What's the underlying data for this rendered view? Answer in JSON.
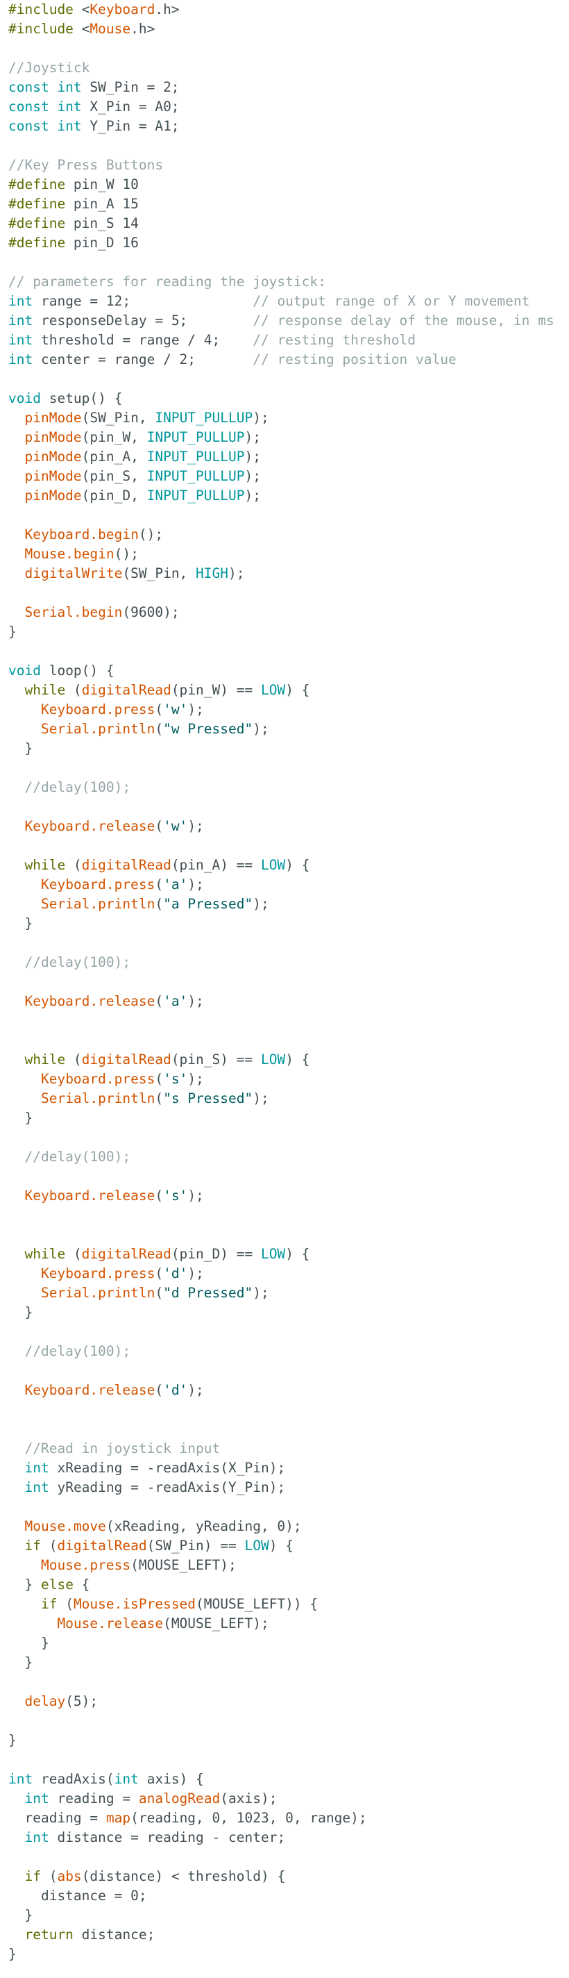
{
  "editor": {
    "language": "Arduino C++",
    "colors": {
      "background": "#ffffff",
      "plain": "#434f54",
      "preprocessor": "#5e6d03",
      "keyword": "#00979c",
      "function": "#d35400",
      "string": "#005c5f",
      "comment": "#95a5a6"
    },
    "lines": [
      [
        [
          "pre",
          "#include"
        ],
        [
          "plain",
          " <"
        ],
        [
          "lib",
          "Keyboard"
        ],
        [
          "plain",
          ".h>"
        ]
      ],
      [
        [
          "pre",
          "#include"
        ],
        [
          "plain",
          " <"
        ],
        [
          "lib",
          "Mouse"
        ],
        [
          "plain",
          ".h>"
        ]
      ],
      [],
      [
        [
          "comment",
          "//Joystick"
        ]
      ],
      [
        [
          "type",
          "const int"
        ],
        [
          "plain",
          " SW_Pin = 2;"
        ]
      ],
      [
        [
          "type",
          "const int"
        ],
        [
          "plain",
          " X_Pin = A0;"
        ]
      ],
      [
        [
          "type",
          "const int"
        ],
        [
          "plain",
          " Y_Pin = A1;"
        ]
      ],
      [],
      [
        [
          "comment",
          "//Key Press Buttons"
        ]
      ],
      [
        [
          "pre",
          "#define"
        ],
        [
          "plain",
          " pin_W 10"
        ]
      ],
      [
        [
          "pre",
          "#define"
        ],
        [
          "plain",
          " pin_A 15"
        ]
      ],
      [
        [
          "pre",
          "#define"
        ],
        [
          "plain",
          " pin_S 14"
        ]
      ],
      [
        [
          "pre",
          "#define"
        ],
        [
          "plain",
          " pin_D 16"
        ]
      ],
      [],
      [
        [
          "comment",
          "// parameters for reading the joystick:"
        ]
      ],
      [
        [
          "type",
          "int"
        ],
        [
          "plain",
          " range = 12;               "
        ],
        [
          "comment",
          "// output range of X or Y movement"
        ]
      ],
      [
        [
          "type",
          "int"
        ],
        [
          "plain",
          " responseDelay = 5;        "
        ],
        [
          "comment",
          "// response delay of the mouse, in ms"
        ]
      ],
      [
        [
          "type",
          "int"
        ],
        [
          "plain",
          " threshold = range / 4;    "
        ],
        [
          "comment",
          "// resting threshold"
        ]
      ],
      [
        [
          "type",
          "int"
        ],
        [
          "plain",
          " center = range / 2;       "
        ],
        [
          "comment",
          "// resting position value"
        ]
      ],
      [],
      [
        [
          "type",
          "void"
        ],
        [
          "plain",
          " setup() {"
        ]
      ],
      [
        [
          "plain",
          "  "
        ],
        [
          "fn",
          "pinMode"
        ],
        [
          "plain",
          "(SW_Pin, "
        ],
        [
          "const",
          "INPUT_PULLUP"
        ],
        [
          "plain",
          ");"
        ]
      ],
      [
        [
          "plain",
          "  "
        ],
        [
          "fn",
          "pinMode"
        ],
        [
          "plain",
          "(pin_W, "
        ],
        [
          "const",
          "INPUT_PULLUP"
        ],
        [
          "plain",
          ");"
        ]
      ],
      [
        [
          "plain",
          "  "
        ],
        [
          "fn",
          "pinMode"
        ],
        [
          "plain",
          "(pin_A, "
        ],
        [
          "const",
          "INPUT_PULLUP"
        ],
        [
          "plain",
          ");"
        ]
      ],
      [
        [
          "plain",
          "  "
        ],
        [
          "fn",
          "pinMode"
        ],
        [
          "plain",
          "(pin_S, "
        ],
        [
          "const",
          "INPUT_PULLUP"
        ],
        [
          "plain",
          ");"
        ]
      ],
      [
        [
          "plain",
          "  "
        ],
        [
          "fn",
          "pinMode"
        ],
        [
          "plain",
          "(pin_D, "
        ],
        [
          "const",
          "INPUT_PULLUP"
        ],
        [
          "plain",
          ");"
        ]
      ],
      [],
      [
        [
          "plain",
          "  "
        ],
        [
          "fn",
          "Keyboard.begin"
        ],
        [
          "plain",
          "();"
        ]
      ],
      [
        [
          "plain",
          "  "
        ],
        [
          "fn",
          "Mouse.begin"
        ],
        [
          "plain",
          "();"
        ]
      ],
      [
        [
          "plain",
          "  "
        ],
        [
          "fn",
          "digitalWrite"
        ],
        [
          "plain",
          "(SW_Pin, "
        ],
        [
          "const",
          "HIGH"
        ],
        [
          "plain",
          ");"
        ]
      ],
      [],
      [
        [
          "plain",
          "  "
        ],
        [
          "fn",
          "Serial.begin"
        ],
        [
          "plain",
          "(9600);"
        ]
      ],
      [
        [
          "plain",
          "}"
        ]
      ],
      [],
      [
        [
          "type",
          "void"
        ],
        [
          "plain",
          " loop() {"
        ]
      ],
      [
        [
          "plain",
          "  "
        ],
        [
          "ctrl",
          "while"
        ],
        [
          "plain",
          " ("
        ],
        [
          "fn",
          "digitalRead"
        ],
        [
          "plain",
          "(pin_W) == "
        ],
        [
          "const",
          "LOW"
        ],
        [
          "plain",
          ") {"
        ]
      ],
      [
        [
          "plain",
          "    "
        ],
        [
          "fn",
          "Keyboard.press"
        ],
        [
          "plain",
          "("
        ],
        [
          "str",
          "'w'"
        ],
        [
          "plain",
          ");"
        ]
      ],
      [
        [
          "plain",
          "    "
        ],
        [
          "fn",
          "Serial.println"
        ],
        [
          "plain",
          "("
        ],
        [
          "str",
          "\"w Pressed\""
        ],
        [
          "plain",
          ");"
        ]
      ],
      [
        [
          "plain",
          "  }"
        ]
      ],
      [],
      [
        [
          "plain",
          "  "
        ],
        [
          "comment",
          "//delay(100);"
        ]
      ],
      [],
      [
        [
          "plain",
          "  "
        ],
        [
          "fn",
          "Keyboard.release"
        ],
        [
          "plain",
          "("
        ],
        [
          "str",
          "'w'"
        ],
        [
          "plain",
          ");"
        ]
      ],
      [],
      [
        [
          "plain",
          "  "
        ],
        [
          "ctrl",
          "while"
        ],
        [
          "plain",
          " ("
        ],
        [
          "fn",
          "digitalRead"
        ],
        [
          "plain",
          "(pin_A) == "
        ],
        [
          "const",
          "LOW"
        ],
        [
          "plain",
          ") {"
        ]
      ],
      [
        [
          "plain",
          "    "
        ],
        [
          "fn",
          "Keyboard.press"
        ],
        [
          "plain",
          "("
        ],
        [
          "str",
          "'a'"
        ],
        [
          "plain",
          ");"
        ]
      ],
      [
        [
          "plain",
          "    "
        ],
        [
          "fn",
          "Serial.println"
        ],
        [
          "plain",
          "("
        ],
        [
          "str",
          "\"a Pressed\""
        ],
        [
          "plain",
          ");"
        ]
      ],
      [
        [
          "plain",
          "  }"
        ]
      ],
      [],
      [
        [
          "plain",
          "  "
        ],
        [
          "comment",
          "//delay(100);"
        ]
      ],
      [],
      [
        [
          "plain",
          "  "
        ],
        [
          "fn",
          "Keyboard.release"
        ],
        [
          "plain",
          "("
        ],
        [
          "str",
          "'a'"
        ],
        [
          "plain",
          ");"
        ]
      ],
      [],
      [],
      [
        [
          "plain",
          "  "
        ],
        [
          "ctrl",
          "while"
        ],
        [
          "plain",
          " ("
        ],
        [
          "fn",
          "digitalRead"
        ],
        [
          "plain",
          "(pin_S) == "
        ],
        [
          "const",
          "LOW"
        ],
        [
          "plain",
          ") {"
        ]
      ],
      [
        [
          "plain",
          "    "
        ],
        [
          "fn",
          "Keyboard.press"
        ],
        [
          "plain",
          "("
        ],
        [
          "str",
          "'s'"
        ],
        [
          "plain",
          ");"
        ]
      ],
      [
        [
          "plain",
          "    "
        ],
        [
          "fn",
          "Serial.println"
        ],
        [
          "plain",
          "("
        ],
        [
          "str",
          "\"s Pressed\""
        ],
        [
          "plain",
          ");"
        ]
      ],
      [
        [
          "plain",
          "  }"
        ]
      ],
      [],
      [
        [
          "plain",
          "  "
        ],
        [
          "comment",
          "//delay(100);"
        ]
      ],
      [],
      [
        [
          "plain",
          "  "
        ],
        [
          "fn",
          "Keyboard.release"
        ],
        [
          "plain",
          "("
        ],
        [
          "str",
          "'s'"
        ],
        [
          "plain",
          ");"
        ]
      ],
      [],
      [],
      [
        [
          "plain",
          "  "
        ],
        [
          "ctrl",
          "while"
        ],
        [
          "plain",
          " ("
        ],
        [
          "fn",
          "digitalRead"
        ],
        [
          "plain",
          "(pin_D) == "
        ],
        [
          "const",
          "LOW"
        ],
        [
          "plain",
          ") {"
        ]
      ],
      [
        [
          "plain",
          "    "
        ],
        [
          "fn",
          "Keyboard.press"
        ],
        [
          "plain",
          "("
        ],
        [
          "str",
          "'d'"
        ],
        [
          "plain",
          ");"
        ]
      ],
      [
        [
          "plain",
          "    "
        ],
        [
          "fn",
          "Serial.println"
        ],
        [
          "plain",
          "("
        ],
        [
          "str",
          "\"d Pressed\""
        ],
        [
          "plain",
          ");"
        ]
      ],
      [
        [
          "plain",
          "  }"
        ]
      ],
      [],
      [
        [
          "plain",
          "  "
        ],
        [
          "comment",
          "//delay(100);"
        ]
      ],
      [],
      [
        [
          "plain",
          "  "
        ],
        [
          "fn",
          "Keyboard.release"
        ],
        [
          "plain",
          "("
        ],
        [
          "str",
          "'d'"
        ],
        [
          "plain",
          ");"
        ]
      ],
      [],
      [],
      [
        [
          "plain",
          "  "
        ],
        [
          "comment",
          "//Read in joystick input"
        ]
      ],
      [
        [
          "plain",
          "  "
        ],
        [
          "type",
          "int"
        ],
        [
          "plain",
          " xReading = -readAxis(X_Pin);"
        ]
      ],
      [
        [
          "plain",
          "  "
        ],
        [
          "type",
          "int"
        ],
        [
          "plain",
          " yReading = -readAxis(Y_Pin);"
        ]
      ],
      [],
      [
        [
          "plain",
          "  "
        ],
        [
          "fn",
          "Mouse.move"
        ],
        [
          "plain",
          "(xReading, yReading, 0);"
        ]
      ],
      [
        [
          "plain",
          "  "
        ],
        [
          "ctrl",
          "if"
        ],
        [
          "plain",
          " ("
        ],
        [
          "fn",
          "digitalRead"
        ],
        [
          "plain",
          "(SW_Pin) == "
        ],
        [
          "const",
          "LOW"
        ],
        [
          "plain",
          ") {"
        ]
      ],
      [
        [
          "plain",
          "    "
        ],
        [
          "fn",
          "Mouse.press"
        ],
        [
          "plain",
          "(MOUSE_LEFT);"
        ]
      ],
      [
        [
          "plain",
          "  } "
        ],
        [
          "ctrl",
          "else"
        ],
        [
          "plain",
          " {"
        ]
      ],
      [
        [
          "plain",
          "    "
        ],
        [
          "ctrl",
          "if"
        ],
        [
          "plain",
          " ("
        ],
        [
          "fn",
          "Mouse.isPressed"
        ],
        [
          "plain",
          "(MOUSE_LEFT)) {"
        ]
      ],
      [
        [
          "plain",
          "      "
        ],
        [
          "fn",
          "Mouse.release"
        ],
        [
          "plain",
          "(MOUSE_LEFT);"
        ]
      ],
      [
        [
          "plain",
          "    }"
        ]
      ],
      [
        [
          "plain",
          "  }"
        ]
      ],
      [],
      [
        [
          "plain",
          "  "
        ],
        [
          "fn",
          "delay"
        ],
        [
          "plain",
          "(5);"
        ]
      ],
      [],
      [
        [
          "plain",
          "}"
        ]
      ],
      [],
      [
        [
          "type",
          "int"
        ],
        [
          "plain",
          " readAxis("
        ],
        [
          "type",
          "int"
        ],
        [
          "plain",
          " axis) {"
        ]
      ],
      [
        [
          "plain",
          "  "
        ],
        [
          "type",
          "int"
        ],
        [
          "plain",
          " reading = "
        ],
        [
          "fn",
          "analogRead"
        ],
        [
          "plain",
          "(axis);"
        ]
      ],
      [
        [
          "plain",
          "  reading = "
        ],
        [
          "fn",
          "map"
        ],
        [
          "plain",
          "(reading, 0, 1023, 0, range);"
        ]
      ],
      [
        [
          "plain",
          "  "
        ],
        [
          "type",
          "int"
        ],
        [
          "plain",
          " distance = reading - center;"
        ]
      ],
      [],
      [
        [
          "plain",
          "  "
        ],
        [
          "ctrl",
          "if"
        ],
        [
          "plain",
          " ("
        ],
        [
          "fn",
          "abs"
        ],
        [
          "plain",
          "(distance) < threshold) {"
        ]
      ],
      [
        [
          "plain",
          "    distance = 0;"
        ]
      ],
      [
        [
          "plain",
          "  }"
        ]
      ],
      [
        [
          "plain",
          "  "
        ],
        [
          "ctrl",
          "return"
        ],
        [
          "plain",
          " distance;"
        ]
      ],
      [
        [
          "plain",
          "}"
        ]
      ]
    ]
  }
}
